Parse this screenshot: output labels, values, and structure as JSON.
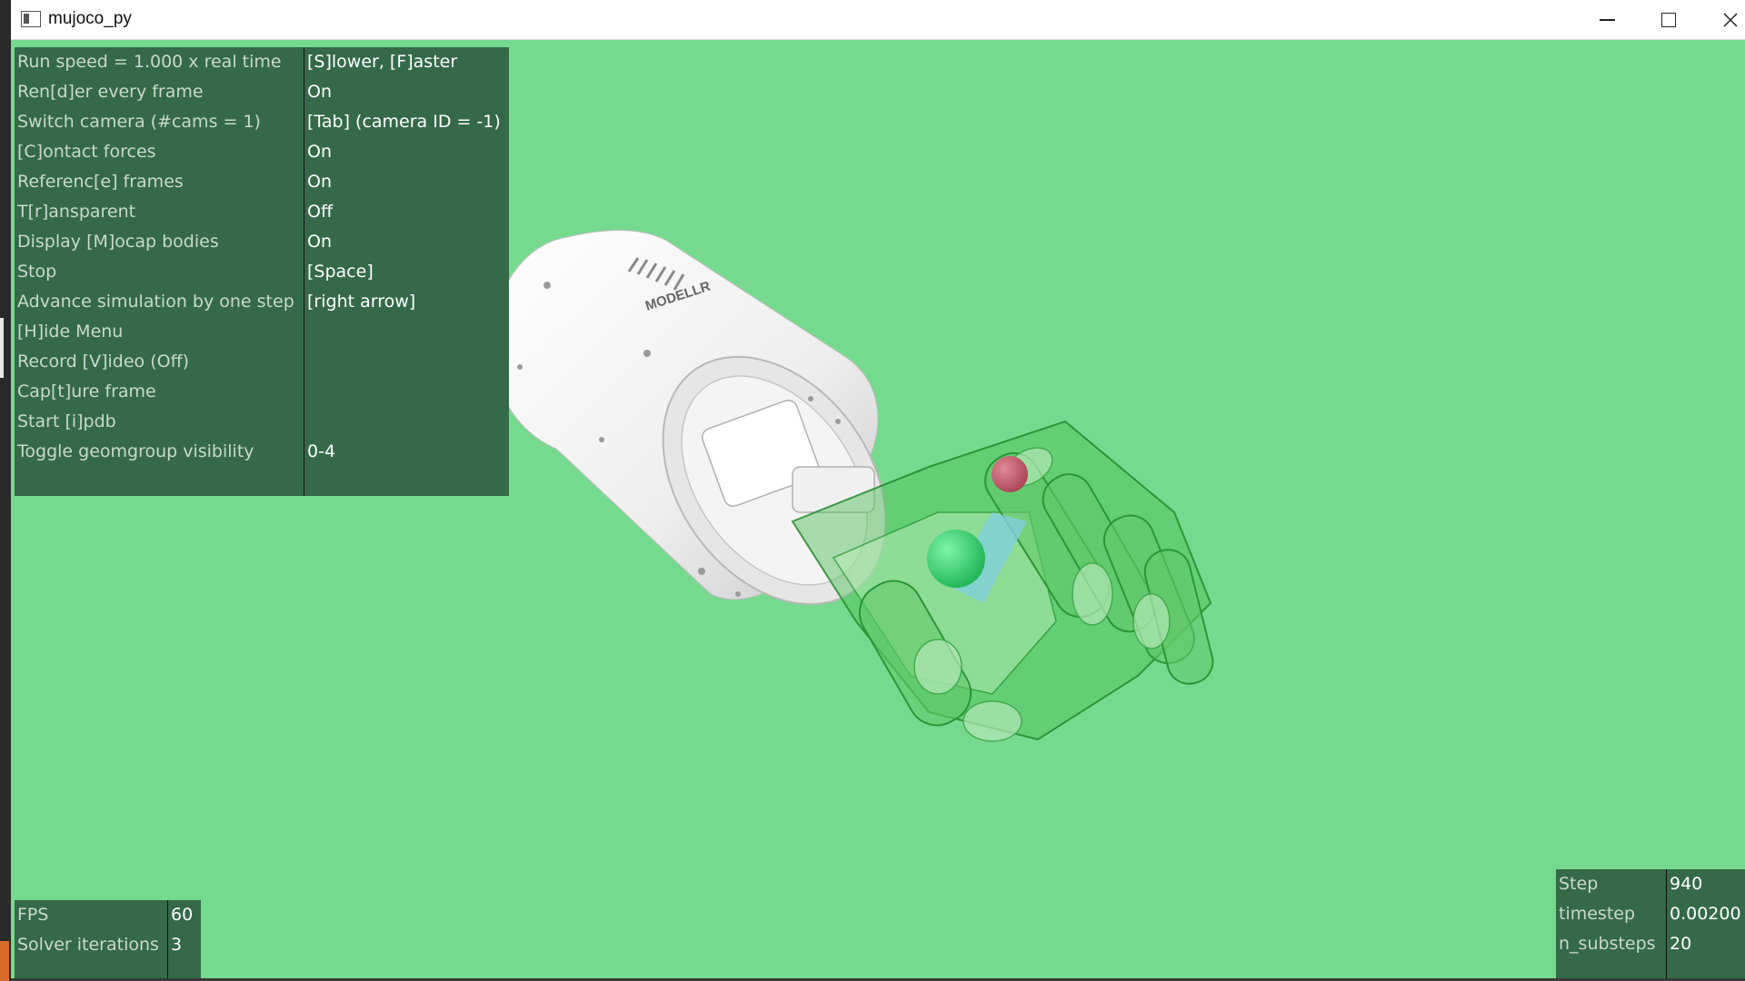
{
  "window": {
    "title": "mujoco_py",
    "buttons": {
      "minimize": "minimize",
      "maximize": "maximize",
      "close": "close"
    }
  },
  "menu": {
    "rows": [
      {
        "label": "Run speed = 1.000 x real time",
        "value": "[S]lower, [F]aster"
      },
      {
        "label": "Ren[d]er every frame",
        "value": "On"
      },
      {
        "label": "Switch camera (#cams = 1)",
        "value": "[Tab] (camera ID = -1)"
      },
      {
        "label": "[C]ontact forces",
        "value": "On"
      },
      {
        "label": "Referenc[e] frames",
        "value": "On"
      },
      {
        "label": "T[r]ansparent",
        "value": "Off"
      },
      {
        "label": "Display [M]ocap bodies",
        "value": "On"
      },
      {
        "label": "Stop",
        "value": "[Space]"
      },
      {
        "label": "Advance simulation by one step",
        "value": "[right arrow]"
      },
      {
        "label": "[H]ide Menu",
        "value": ""
      },
      {
        "label": "Record [V]ideo (Off)",
        "value": ""
      },
      {
        "label": "Cap[t]ure frame",
        "value": ""
      },
      {
        "label": "Start [i]pdb",
        "value": ""
      },
      {
        "label": "Toggle geomgroup visibility",
        "value": "0-4"
      }
    ]
  },
  "stats_left": {
    "rows": [
      {
        "label": "FPS",
        "value": "60"
      },
      {
        "label": "Solver iterations",
        "value": "3"
      }
    ]
  },
  "stats_right": {
    "rows": [
      {
        "label": "Step",
        "value": "940"
      },
      {
        "label": "timestep",
        "value": "0.00200"
      },
      {
        "label": "n_substeps",
        "value": "20"
      }
    ]
  },
  "scene": {
    "background_color": "#76da8e",
    "arm_color": "#f2f2f2",
    "hand_color": "#2eaa38",
    "target_color": "#c45a6a",
    "ball_color": "#3ddc78",
    "arm_logo_text": "MODELLR"
  }
}
